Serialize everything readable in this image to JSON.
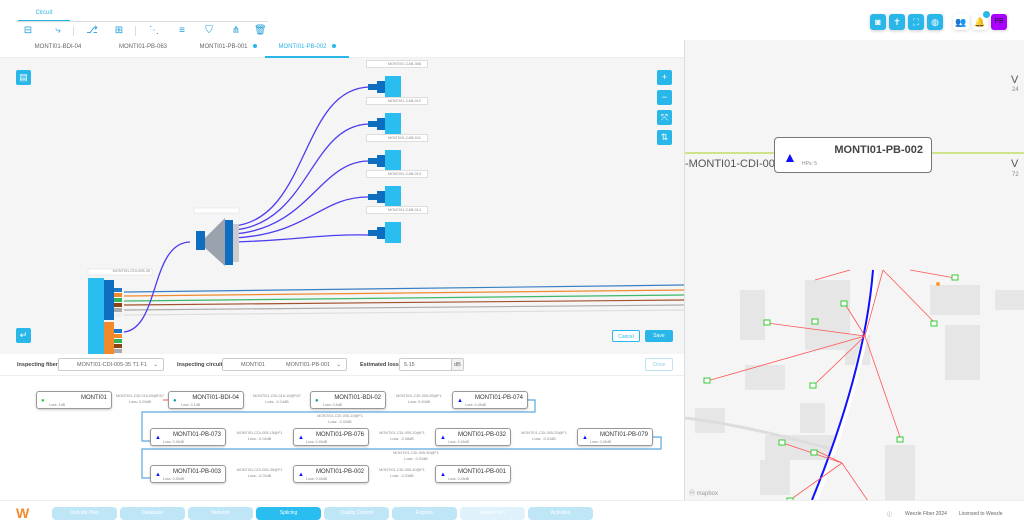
{
  "toolbar": {
    "tab_label": "Circuit",
    "tools": [
      "layer-add-icon",
      "route-icon",
      "connect-icon",
      "box-split-icon",
      "splice-icon",
      "fiber-list-icon",
      "merge-icon",
      "branch-icon",
      "trash-icon"
    ]
  },
  "header_right": {
    "buttons": [
      "camera-icon",
      "person-icon",
      "fullscreen-icon",
      "globe-icon"
    ],
    "users_icon": "users-icon",
    "bell_icon": "bell-icon",
    "avatar": "PB",
    "avatar_color": "#aa00ff",
    "accent": "#29b6e8"
  },
  "tabs": [
    {
      "label": "MONTI01-BDI-04",
      "dot": false
    },
    {
      "label": "MONTI01-PB-063",
      "dot": false
    },
    {
      "label": "MONTI01-PB-001",
      "dot": true
    },
    {
      "label": "MONTI01-PB-002",
      "dot": true,
      "active": true
    }
  ],
  "diagram": {
    "cables": [
      "MONTI01-CAB-358",
      "MONTI01-CAB-012",
      "MONTI01-CAB-011",
      "MONTI01-CAB-013",
      "MONTI01-CAB-014"
    ],
    "source": "MONTI01-CDI-005-35",
    "cancel": "Cancel",
    "save": "Save",
    "zoom_in": "+",
    "zoom_out": "−"
  },
  "inspect": {
    "fiber_label": "Inspecting fiber:",
    "fiber_value": "MONTI01-CDI-005-35 T1 F1",
    "circuit_label": "Inspecting circuit:",
    "circuit_from": "MONTI01",
    "circuit_to": "MONTI01-PB-001",
    "loss_label": "Estimated loss:",
    "loss_value": "5.15",
    "loss_unit": "dB",
    "close": "Close"
  },
  "path": {
    "rows": [
      {
        "nodes": [
          {
            "name": "MONTI01",
            "loss": "Loss: 1dB",
            "type": "olt"
          },
          {
            "name": "MONTI01-BDI-04",
            "loss": "Loss: 0.1dB",
            "type": "bdi"
          },
          {
            "name": "MONTI01-BDI-02",
            "loss": "Loss: 0.5dB",
            "type": "bdi"
          },
          {
            "name": "MONTI01-PB-074",
            "loss": "Loss: 0.45dB",
            "type": "pb"
          }
        ],
        "links": [
          {
            "name": "MONTI01-CDI-016-05@FA7",
            "loss": "Loss: 0.00dB"
          },
          {
            "name": "MONTI01-CDI-016-10@FA7",
            "loss": "Loss: -0.14dB"
          },
          {
            "name": "MONTI01-CDI-005-05@F1",
            "loss": "Loss: 0.00dB"
          }
        ]
      },
      {
        "nodes": [
          {
            "name": "MONTI01-PB-073",
            "loss": "Loss: 0.45dB",
            "type": "pb"
          },
          {
            "name": "MONTI01-PB-076",
            "loss": "Loss: 0.45dB",
            "type": "pb"
          },
          {
            "name": "MONTI01-PB-032",
            "loss": "Loss: 0.45dB",
            "type": "pb"
          },
          {
            "name": "MONTI01-PB-079",
            "loss": "Loss: 0.45dB",
            "type": "pb"
          }
        ],
        "links": [
          {
            "name": "MONTI01-CDI-005-15@F1",
            "loss": "Loss: -0.04dB"
          },
          {
            "name": "MONTI01-CDI-005-20@F1",
            "loss": "Loss: -0.08dB"
          },
          {
            "name": "MONTI01-CDI-005-25@F1",
            "loss": "Loss: -0.01dB"
          }
        ]
      },
      {
        "nodes": [
          {
            "name": "MONTI01-PB-003",
            "loss": "Loss: 0.45dB",
            "type": "pb"
          },
          {
            "name": "MONTI01-PB-002",
            "loss": "Loss: 0.45dB",
            "type": "pb"
          },
          {
            "name": "MONTI01-PB-001",
            "loss": "Loss: 0.45dB",
            "type": "pb"
          }
        ],
        "links": [
          {
            "name": "MONTI01-CDI-005-35@F1",
            "loss": "Loss: -0.02dB"
          },
          {
            "name": "MONTI01-CDI-005-40@F1",
            "loss": "Loss: -0.03dB"
          }
        ]
      }
    ],
    "connectors": [
      {
        "name": "MONTI01-CDI-005-10@F1",
        "loss": "Loss: -0.02dB"
      },
      {
        "name": "MONTI01-CDI-005-30@F1",
        "loss": "Loss: -0.01dB"
      }
    ]
  },
  "map": {
    "node_name": "MONTI01-PB-002",
    "node_hps": "HPs: 5",
    "left_cable": "-MONTI01-CDI-00",
    "right_top": "V",
    "right_top_sub": "24",
    "right_bottom": "V",
    "right_bottom_sub": "72",
    "attribution": "mapbox"
  },
  "bottom_nav": [
    {
      "label": "Outside Plan"
    },
    {
      "label": "Database"
    },
    {
      "label": "Network"
    },
    {
      "label": "Splicing",
      "active": true
    },
    {
      "label": "Quality Control"
    },
    {
      "label": "Exports"
    },
    {
      "label": "Inside Plan"
    },
    {
      "label": "Activities"
    }
  ],
  "footer": {
    "info_icon": "info-icon",
    "product": "Weezle Fiber 2024",
    "license": "Licensed to Weezle"
  }
}
